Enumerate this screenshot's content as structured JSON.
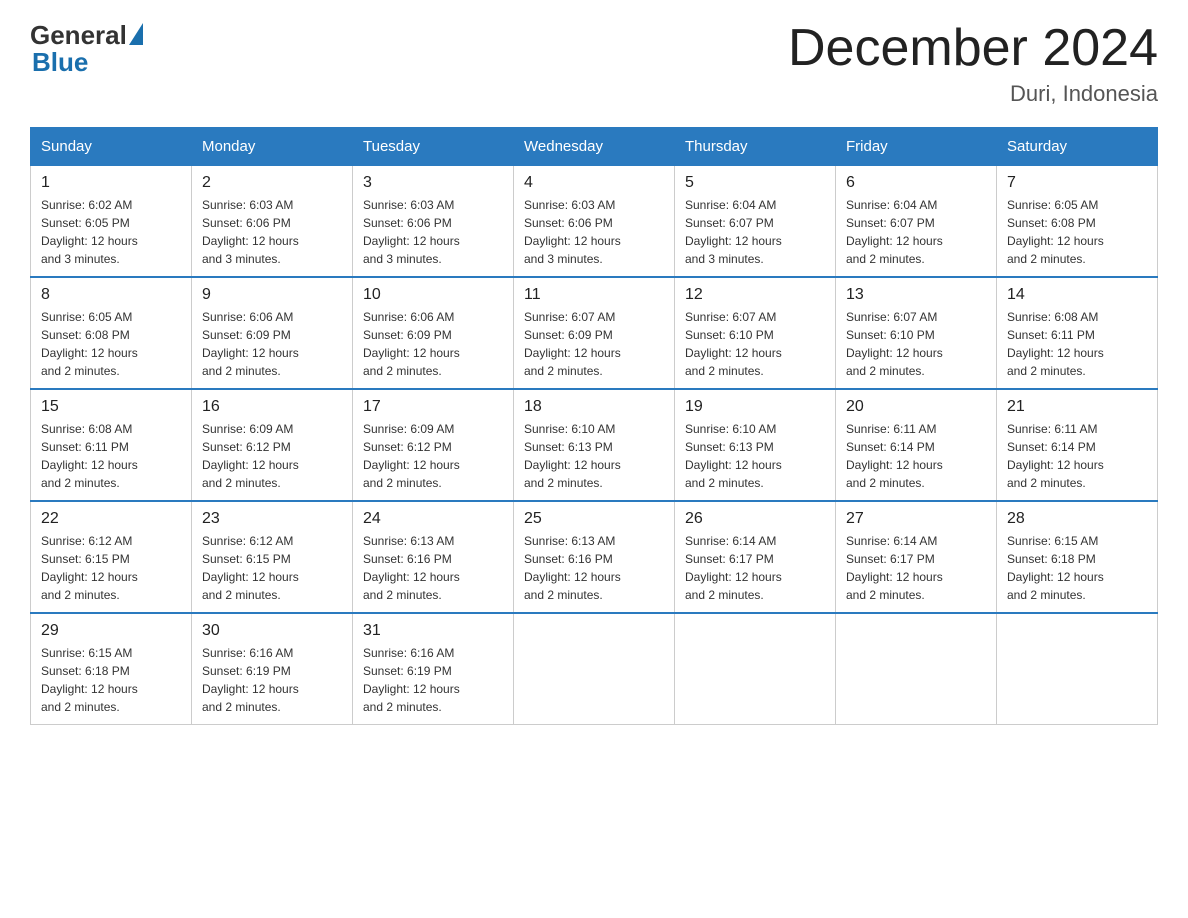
{
  "header": {
    "logo_general": "General",
    "logo_blue": "Blue",
    "title": "December 2024",
    "location": "Duri, Indonesia"
  },
  "days_of_week": [
    "Sunday",
    "Monday",
    "Tuesday",
    "Wednesday",
    "Thursday",
    "Friday",
    "Saturday"
  ],
  "weeks": [
    [
      {
        "day": 1,
        "sunrise": "6:02 AM",
        "sunset": "6:05 PM",
        "daylight": "12 hours and 3 minutes."
      },
      {
        "day": 2,
        "sunrise": "6:03 AM",
        "sunset": "6:06 PM",
        "daylight": "12 hours and 3 minutes."
      },
      {
        "day": 3,
        "sunrise": "6:03 AM",
        "sunset": "6:06 PM",
        "daylight": "12 hours and 3 minutes."
      },
      {
        "day": 4,
        "sunrise": "6:03 AM",
        "sunset": "6:06 PM",
        "daylight": "12 hours and 3 minutes."
      },
      {
        "day": 5,
        "sunrise": "6:04 AM",
        "sunset": "6:07 PM",
        "daylight": "12 hours and 3 minutes."
      },
      {
        "day": 6,
        "sunrise": "6:04 AM",
        "sunset": "6:07 PM",
        "daylight": "12 hours and 2 minutes."
      },
      {
        "day": 7,
        "sunrise": "6:05 AM",
        "sunset": "6:08 PM",
        "daylight": "12 hours and 2 minutes."
      }
    ],
    [
      {
        "day": 8,
        "sunrise": "6:05 AM",
        "sunset": "6:08 PM",
        "daylight": "12 hours and 2 minutes."
      },
      {
        "day": 9,
        "sunrise": "6:06 AM",
        "sunset": "6:09 PM",
        "daylight": "12 hours and 2 minutes."
      },
      {
        "day": 10,
        "sunrise": "6:06 AM",
        "sunset": "6:09 PM",
        "daylight": "12 hours and 2 minutes."
      },
      {
        "day": 11,
        "sunrise": "6:07 AM",
        "sunset": "6:09 PM",
        "daylight": "12 hours and 2 minutes."
      },
      {
        "day": 12,
        "sunrise": "6:07 AM",
        "sunset": "6:10 PM",
        "daylight": "12 hours and 2 minutes."
      },
      {
        "day": 13,
        "sunrise": "6:07 AM",
        "sunset": "6:10 PM",
        "daylight": "12 hours and 2 minutes."
      },
      {
        "day": 14,
        "sunrise": "6:08 AM",
        "sunset": "6:11 PM",
        "daylight": "12 hours and 2 minutes."
      }
    ],
    [
      {
        "day": 15,
        "sunrise": "6:08 AM",
        "sunset": "6:11 PM",
        "daylight": "12 hours and 2 minutes."
      },
      {
        "day": 16,
        "sunrise": "6:09 AM",
        "sunset": "6:12 PM",
        "daylight": "12 hours and 2 minutes."
      },
      {
        "day": 17,
        "sunrise": "6:09 AM",
        "sunset": "6:12 PM",
        "daylight": "12 hours and 2 minutes."
      },
      {
        "day": 18,
        "sunrise": "6:10 AM",
        "sunset": "6:13 PM",
        "daylight": "12 hours and 2 minutes."
      },
      {
        "day": 19,
        "sunrise": "6:10 AM",
        "sunset": "6:13 PM",
        "daylight": "12 hours and 2 minutes."
      },
      {
        "day": 20,
        "sunrise": "6:11 AM",
        "sunset": "6:14 PM",
        "daylight": "12 hours and 2 minutes."
      },
      {
        "day": 21,
        "sunrise": "6:11 AM",
        "sunset": "6:14 PM",
        "daylight": "12 hours and 2 minutes."
      }
    ],
    [
      {
        "day": 22,
        "sunrise": "6:12 AM",
        "sunset": "6:15 PM",
        "daylight": "12 hours and 2 minutes."
      },
      {
        "day": 23,
        "sunrise": "6:12 AM",
        "sunset": "6:15 PM",
        "daylight": "12 hours and 2 minutes."
      },
      {
        "day": 24,
        "sunrise": "6:13 AM",
        "sunset": "6:16 PM",
        "daylight": "12 hours and 2 minutes."
      },
      {
        "day": 25,
        "sunrise": "6:13 AM",
        "sunset": "6:16 PM",
        "daylight": "12 hours and 2 minutes."
      },
      {
        "day": 26,
        "sunrise": "6:14 AM",
        "sunset": "6:17 PM",
        "daylight": "12 hours and 2 minutes."
      },
      {
        "day": 27,
        "sunrise": "6:14 AM",
        "sunset": "6:17 PM",
        "daylight": "12 hours and 2 minutes."
      },
      {
        "day": 28,
        "sunrise": "6:15 AM",
        "sunset": "6:18 PM",
        "daylight": "12 hours and 2 minutes."
      }
    ],
    [
      {
        "day": 29,
        "sunrise": "6:15 AM",
        "sunset": "6:18 PM",
        "daylight": "12 hours and 2 minutes."
      },
      {
        "day": 30,
        "sunrise": "6:16 AM",
        "sunset": "6:19 PM",
        "daylight": "12 hours and 2 minutes."
      },
      {
        "day": 31,
        "sunrise": "6:16 AM",
        "sunset": "6:19 PM",
        "daylight": "12 hours and 2 minutes."
      },
      null,
      null,
      null,
      null
    ]
  ]
}
